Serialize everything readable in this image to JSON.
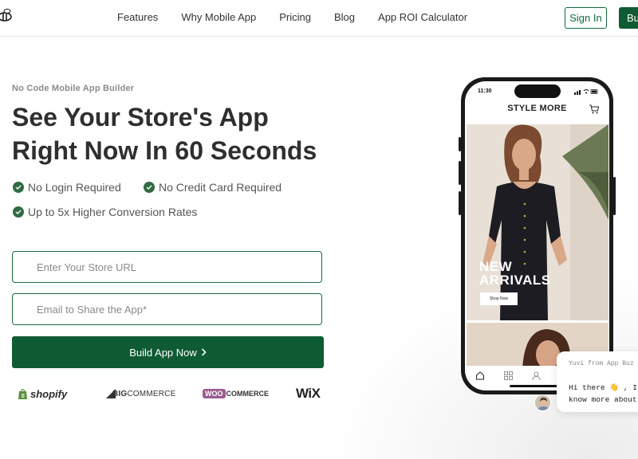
{
  "nav": {
    "links": [
      "Features",
      "Why Mobile App",
      "Pricing",
      "Blog",
      "App ROI Calculator"
    ],
    "signin": "Sign In",
    "buy": "Bu"
  },
  "hero": {
    "eyebrow": "No Code Mobile App Builder",
    "title_line1": "See Your Store's App",
    "title_line2": "Right Now In 60 Seconds",
    "checks": [
      "No Login Required",
      "No Credit Card Required",
      "Up to 5x Higher Conversion Rates"
    ],
    "store_url_placeholder": "Enter Your Store URL",
    "email_placeholder": "Email to Share the App*",
    "cta": "Build App Now"
  },
  "brands": {
    "shopify": "shopify",
    "bigcommerce_big": "BIG",
    "bigcommerce_rest": "COMMERCE",
    "woo_badge": "WOO",
    "woo_rest": "COMMERCE",
    "wix": "WiX"
  },
  "phone": {
    "time": "11:30",
    "store_title": "STYLE MORE",
    "banner_line1": "NEW",
    "banner_line2": "ARRIVALS",
    "shop_now": "Shop Now"
  },
  "chat": {
    "from": "Yuvi from App Buz",
    "message": "Hi there 👋 , I\nknow more about"
  },
  "colors": {
    "brand_green": "#0e5b34",
    "check_green": "#2f6b43"
  }
}
